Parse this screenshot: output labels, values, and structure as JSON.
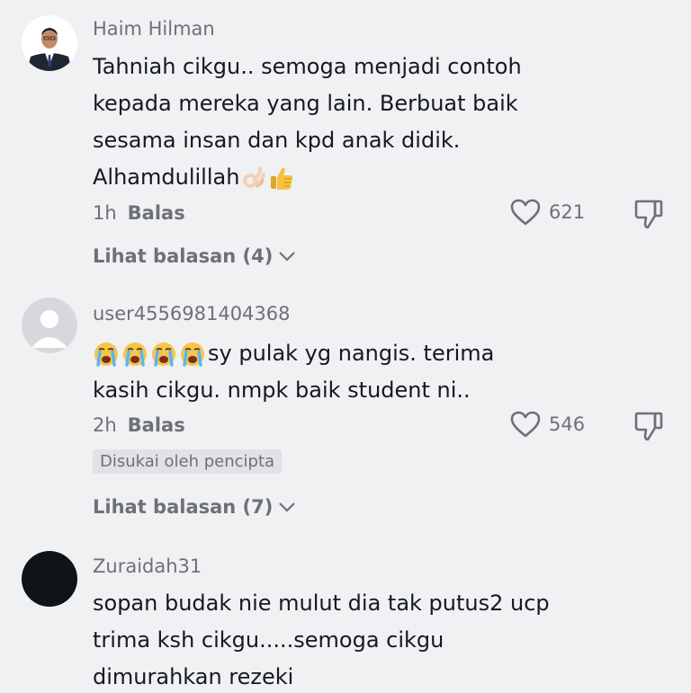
{
  "comments": [
    {
      "username": "Haim Hilman",
      "lines": [
        "Tahniah cikgu.. semoga menjadi contoh",
        "kepada mereka yang lain. Berbuat baik",
        "sesama insan dan kpd anak didik.",
        "Alhamdulillah"
      ],
      "emojis_after_text": [
        "ok-hand-emoji",
        "thumbs-up-emoji"
      ],
      "time": "1h",
      "reply_label": "Balas",
      "likes": "621",
      "view_replies": "Lihat balasan (4)",
      "avatar": "profile-photo-man-in-suit"
    },
    {
      "username": "user4556981404368",
      "emojis_before_text": [
        "crying-emoji",
        "crying-emoji",
        "crying-emoji",
        "crying-emoji"
      ],
      "lines": [
        "sy pulak yg nangis. terima",
        "kasih cikgu. nmpk baik student ni.."
      ],
      "time": "2h",
      "reply_label": "Balas",
      "likes": "546",
      "creator_badge": "Disukai oleh pencipta",
      "view_replies": "Lihat balasan (7)",
      "avatar": "default-avatar"
    },
    {
      "username": "Zuraidah31",
      "lines": [
        "sopan budak nie mulut dia tak putus2 ucp",
        "trima ksh cikgu.....semoga cikgu",
        "dimurahkan rezeki"
      ],
      "avatar": "black-avatar"
    }
  ],
  "icons": {
    "like": "heart-outline-icon",
    "dislike": "thumbs-down-icon",
    "expand": "chevron-down-icon"
  },
  "colors": {
    "background": "#f0f1f3",
    "primary_text": "#161823",
    "secondary_text": "#6e7079",
    "badge_background": "#e1e2e5"
  }
}
